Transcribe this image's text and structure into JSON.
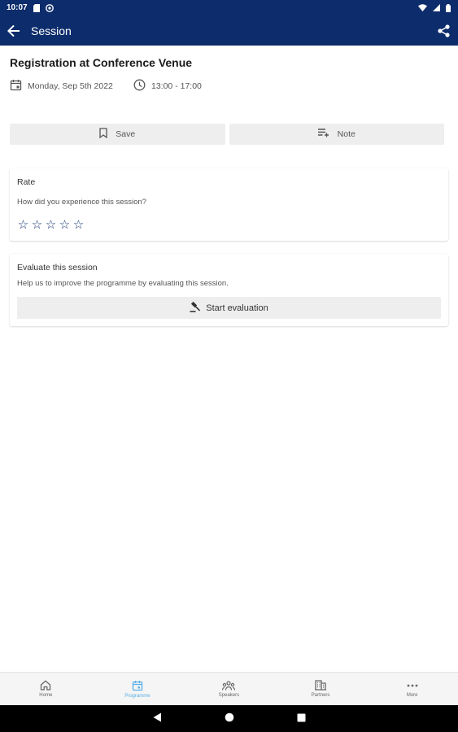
{
  "status_bar": {
    "time": "10:07"
  },
  "app_bar": {
    "title": "Session"
  },
  "session": {
    "title": "Registration at Conference Venue",
    "date": "Monday, Sep 5th 2022",
    "time": "13:00 - 17:00"
  },
  "actions": {
    "save_label": "Save",
    "note_label": "Note"
  },
  "rate_card": {
    "title": "Rate",
    "prompt": "How did you experience this session?",
    "rating": 0,
    "max_rating": 5
  },
  "evaluate_card": {
    "title": "Evaluate this session",
    "description": "Help us to improve the programme by evaluating this session.",
    "button_label": "Start evaluation"
  },
  "bottom_nav": {
    "items": [
      {
        "label": "Home",
        "icon": "home-icon",
        "active": false
      },
      {
        "label": "Programme",
        "icon": "calendar-icon",
        "active": true
      },
      {
        "label": "Speakers",
        "icon": "people-icon",
        "active": false
      },
      {
        "label": "Partners",
        "icon": "building-icon",
        "active": false
      },
      {
        "label": "More",
        "icon": "more-icon",
        "active": false
      }
    ]
  },
  "colors": {
    "primary": "#0d2c6b",
    "active_tab": "#5aaee6",
    "button_bg": "#eeeeee"
  }
}
